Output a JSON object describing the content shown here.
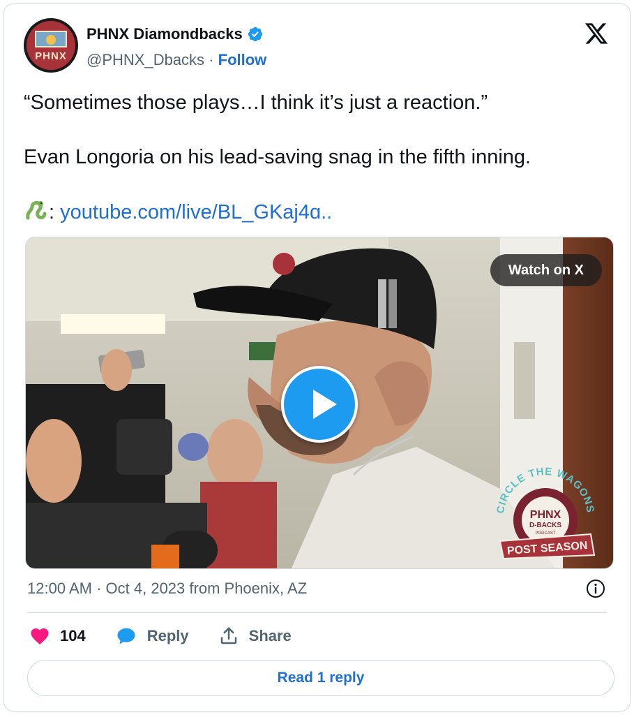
{
  "author": {
    "display_name": "PHNX Diamondbacks",
    "handle": "@PHNX_Dbacks",
    "separator": "·",
    "follow_label": "Follow",
    "avatar_text": "PHNX",
    "verified": true
  },
  "tweet": {
    "line1": "“Sometimes those plays…I think it’s just a reaction.”",
    "line2": "Evan Longoria on his lead-saving snag in the fifth inning.",
    "link_prefix": ":",
    "link_text": "youtube.com/live/BL_GKaj4ɑ.."
  },
  "media": {
    "watch_label": "Watch on X",
    "overlay_logo": {
      "arc_text": "CIRCLE THE WAGONS",
      "name": "PHNX",
      "sub": "D-BACKS",
      "small": "PODCAST",
      "banner": "POST SEASON"
    }
  },
  "meta": {
    "time": "12:00 AM",
    "separator": "·",
    "date": "Oct 4, 2023",
    "location": "from Phoenix, AZ"
  },
  "actions": {
    "like_count": "104",
    "reply_label": "Reply",
    "share_label": "Share"
  },
  "read_reply_label": "Read 1 reply",
  "colors": {
    "accent": "#1d9bf0",
    "link": "#1d6fd6",
    "like": "#f91880",
    "muted": "#536471",
    "border": "#cfd9de"
  }
}
